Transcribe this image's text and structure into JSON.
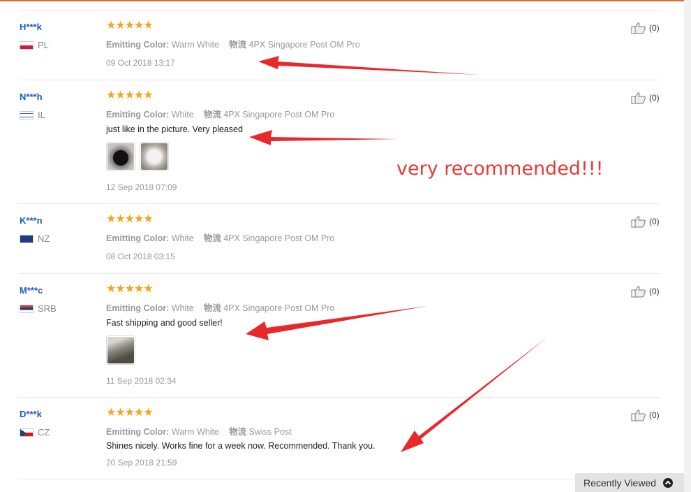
{
  "reviews": [
    {
      "user": "H***k",
      "country": "PL",
      "stars": "★★★★★",
      "attr_label": "Emitting Color:",
      "attr_value": "Warm White",
      "ship_label": "物流",
      "ship_value": "4PX Singapore Post OM Pro",
      "comment": "",
      "date": "09 Oct 2018 13:17",
      "helpful": "(0)"
    },
    {
      "user": "N***h",
      "country": "IL",
      "stars": "★★★★★",
      "attr_label": "Emitting Color:",
      "attr_value": "White",
      "ship_label": "物流",
      "ship_value": "4PX Singapore Post OM Pro",
      "comment": "just like in the picture. Very pleased",
      "date": "12 Sep 2018 07:09",
      "helpful": "(0)"
    },
    {
      "user": "K***n",
      "country": "NZ",
      "stars": "★★★★★",
      "attr_label": "Emitting Color:",
      "attr_value": "White",
      "ship_label": "物流",
      "ship_value": "4PX Singapore Post OM Pro",
      "comment": "",
      "date": "08 Oct 2018 03:15",
      "helpful": "(0)"
    },
    {
      "user": "M***c",
      "country": "SRB",
      "stars": "★★★★★",
      "attr_label": "Emitting Color:",
      "attr_value": "White",
      "ship_label": "物流",
      "ship_value": "4PX Singapore Post OM Pro",
      "comment": "Fast shipping and good seller!",
      "date": "11 Sep 2018 02:34",
      "helpful": "(0)"
    },
    {
      "user": "D***k",
      "country": "CZ",
      "stars": "★★★★★",
      "attr_label": "Emitting Color:",
      "attr_value": "Warm White",
      "ship_label": "物流",
      "ship_value": "Swiss Post",
      "comment": "Shines nicely. Works fine for a week now. Recommended. Thank you.",
      "date": "20 Sep 2018 21:59",
      "helpful": "(0)"
    }
  ],
  "annotation": "very recommended!!!",
  "recently_viewed": "Recently Viewed",
  "colors": {
    "username": "#1a5eb8",
    "star": "#f5a41c",
    "annotation": "#e23c36",
    "arrow": "#e8282b"
  }
}
